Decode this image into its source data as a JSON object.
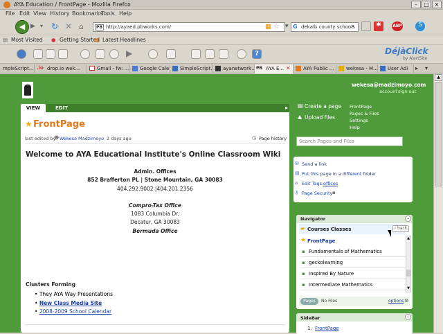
{
  "window": {
    "title": "AYA Education / FrontPage - Mozilla Firefox"
  },
  "menu": [
    "File",
    "Edit",
    "View",
    "History",
    "Bookmarks",
    "Tools",
    "Help"
  ],
  "nav": {
    "url": "http://ayaed.pbworks.com/",
    "search": "dekalb county schools"
  },
  "bookmarks": [
    "Most Visited",
    "Getting Started",
    "Latest Headlines"
  ],
  "brand": {
    "deja": "DéjàClick",
    "by": "by AlertSite"
  },
  "tabs": [
    "mpleScript...",
    "drop.io wek...",
    "Gmail - fw: ...",
    "Google Cale...",
    "SimpleScript...",
    "ayanetwork...",
    "AYA E...",
    "AYA Public ...",
    "wekesa - M...",
    "User Adi"
  ],
  "user": {
    "email": "wekesa@madzimoyo.com",
    "account": "account",
    "signout": "sign out"
  },
  "editor": {
    "view": "VIEW",
    "edit": "EDIT"
  },
  "actions": {
    "create": "Create a page",
    "upload": "Upload files"
  },
  "links": {
    "frontpage": "FrontPage",
    "pages": "Pages & Files",
    "settings": "Settings",
    "help": "Help"
  },
  "search": {
    "placeholder": "Search Pages and Files"
  },
  "page": {
    "title": "FrontPage",
    "edited_prefix": "last edited by",
    "editor_name": "Wekesa Madzimoyo",
    "edited_when": "2 days ago",
    "history": "Page history",
    "heading": "Welcome to AYA Educational Institute's Online Classroom Wiki",
    "office_title": "Admin. Offices",
    "office_addr": "852 Brafferton PL | Stone Mountain, GA 30083",
    "office_phone": "404.292.9002 |404.201.2356",
    "ct_title": "Compro-Tax Office",
    "ct_addr1": "1083 Columbia Dr.",
    "ct_addr2": "Decatur, GA 30083",
    "bermuda": "Bermuda Office",
    "clusters_title": "Clusters Forming",
    "clusters": [
      "They AYA Way Presentations",
      "New Class Media Site",
      "2008-2009 School Calendar"
    ]
  },
  "tools": {
    "send": "Send a link",
    "move": "Put this page in a different folder",
    "tags_label": "Edit Tags:",
    "tags_value": "offices",
    "security": "Page Security"
  },
  "navigator": {
    "title": "Navigator",
    "folder": "Courses Classes",
    "back": "back",
    "items": [
      "FrontPage",
      "Fundamentals of Mathematics",
      "geckolearning",
      "Inspired By Nature",
      "Intermediate Mathematics"
    ],
    "pages": "Pages",
    "nofiles": "No Files",
    "options": "options"
  },
  "sidebar": {
    "title": "SideBar",
    "item1": "1.",
    "item1_link": "FrontPage"
  }
}
